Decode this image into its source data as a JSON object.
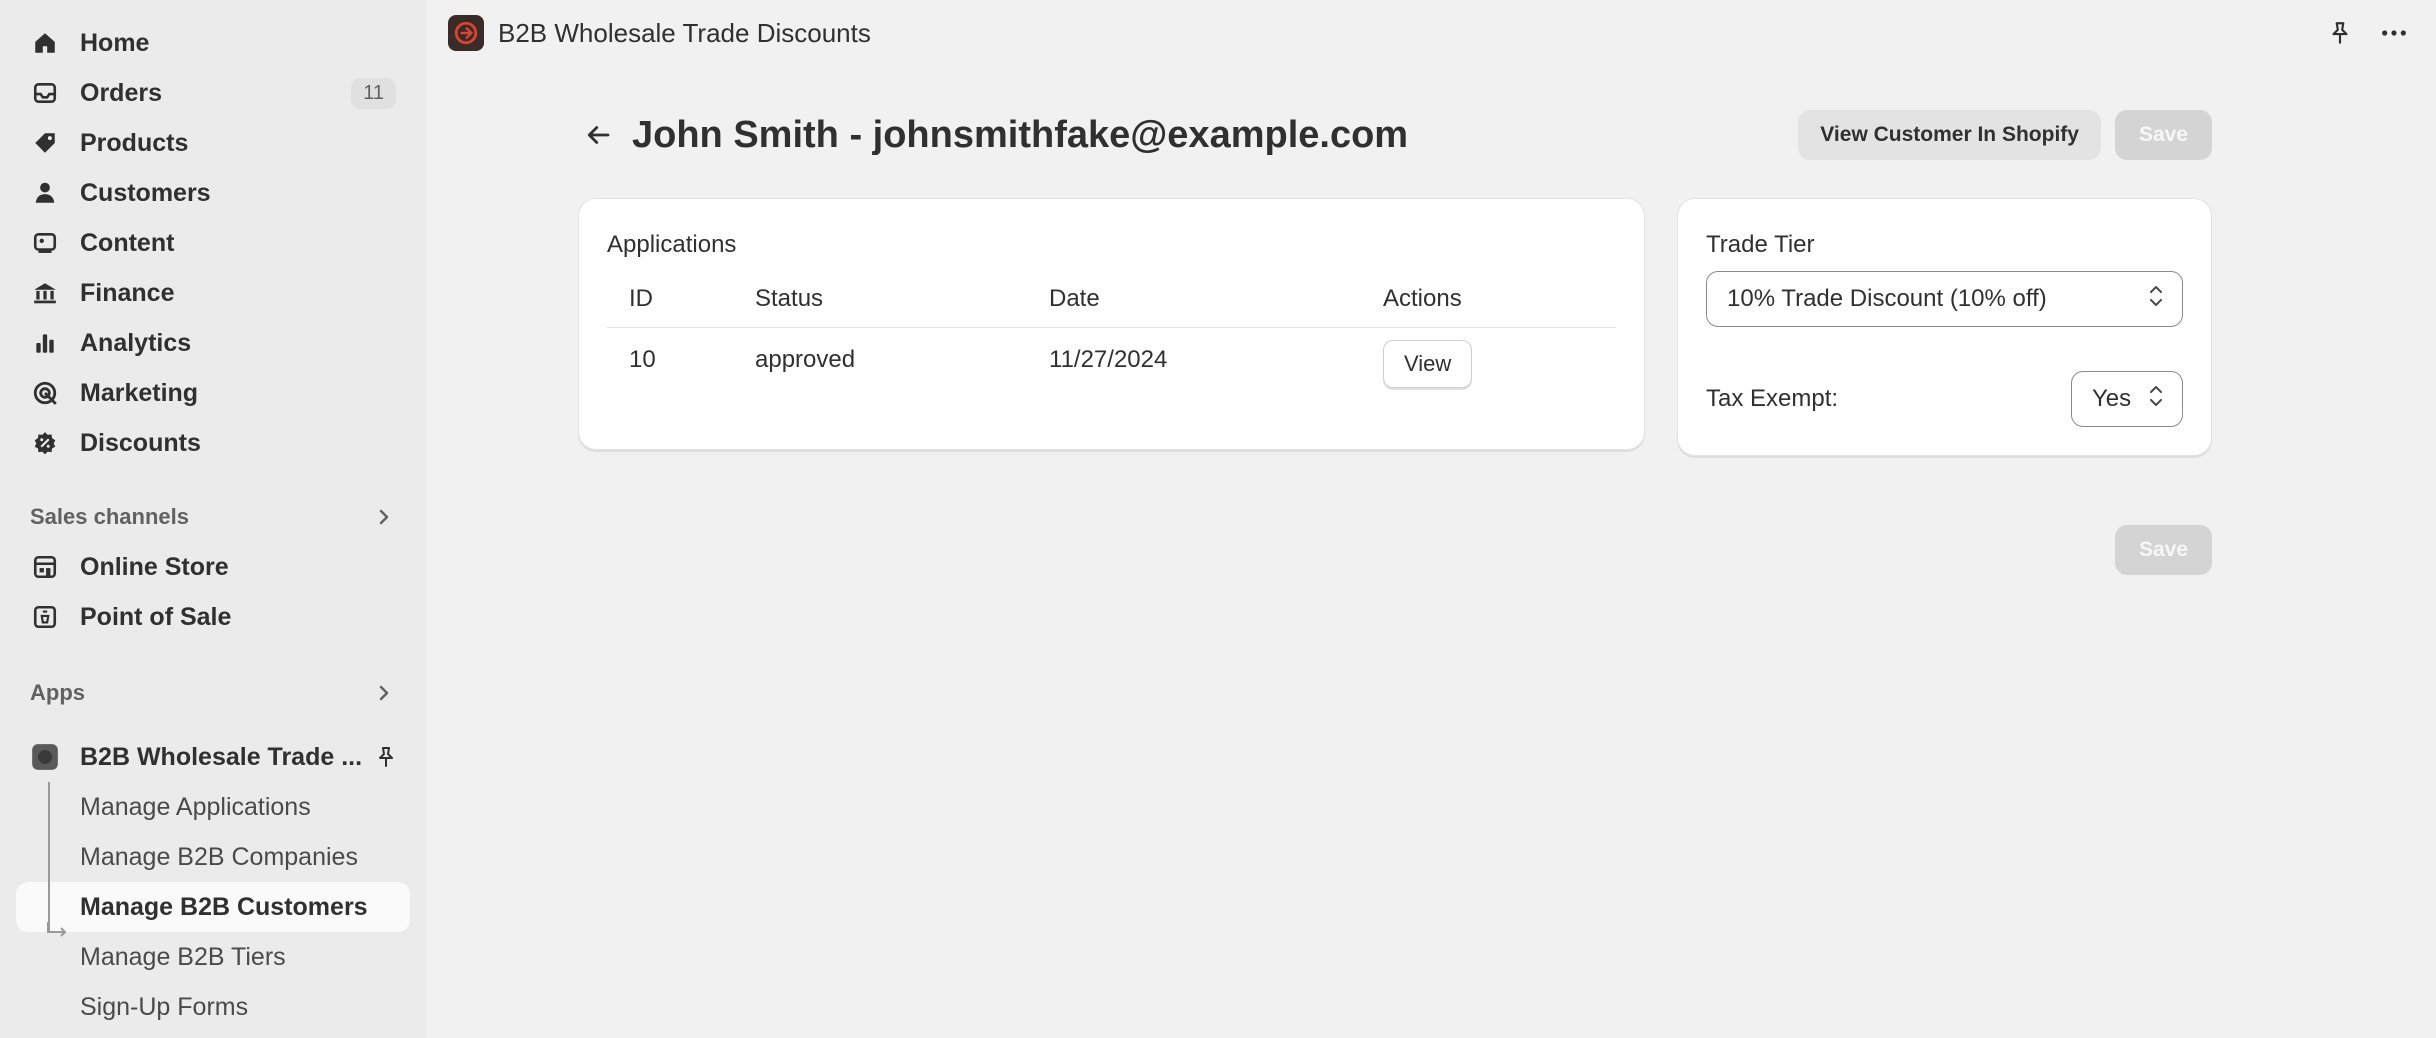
{
  "sidebar": {
    "nav": [
      {
        "label": "Home",
        "icon": "home-icon"
      },
      {
        "label": "Orders",
        "icon": "inbox-icon",
        "badge": "11"
      },
      {
        "label": "Products",
        "icon": "tag-icon"
      },
      {
        "label": "Customers",
        "icon": "person-icon"
      },
      {
        "label": "Content",
        "icon": "image-icon"
      },
      {
        "label": "Finance",
        "icon": "bank-icon"
      },
      {
        "label": "Analytics",
        "icon": "bar-chart-icon"
      },
      {
        "label": "Marketing",
        "icon": "target-icon"
      },
      {
        "label": "Discounts",
        "icon": "discount-icon"
      }
    ],
    "sales_channels": {
      "heading": "Sales channels",
      "items": [
        {
          "label": "Online Store",
          "icon": "store-icon"
        },
        {
          "label": "Point of Sale",
          "icon": "pos-icon"
        }
      ]
    },
    "apps": {
      "heading": "Apps",
      "app_name": "B2B Wholesale Trade ...",
      "sub_items": [
        {
          "label": "Manage Applications"
        },
        {
          "label": "Manage B2B Companies"
        },
        {
          "label": "Manage B2B Customers",
          "active": true
        },
        {
          "label": "Manage B2B Tiers"
        },
        {
          "label": "Sign-Up Forms"
        }
      ]
    }
  },
  "topbar": {
    "title": "B2B Wholesale Trade Discounts"
  },
  "page": {
    "title": "John Smith - johnsmithfake@example.com",
    "view_customer_label": "View Customer In Shopify",
    "save_label": "Save"
  },
  "applications": {
    "heading": "Applications",
    "columns": [
      "ID",
      "Status",
      "Date",
      "Actions"
    ],
    "rows": [
      {
        "id": "10",
        "status": "approved",
        "date": "11/27/2024",
        "action": "View"
      }
    ]
  },
  "trade": {
    "tier_label": "Trade Tier",
    "tier_value": "10% Trade Discount (10% off)",
    "tax_label": "Tax Exempt:",
    "tax_value": "Yes"
  },
  "colors": {
    "sidebar_bg": "#ebebeb",
    "page_bg": "#f1f1f1",
    "card_bg": "#ffffff",
    "disabled_btn": "#d4d4d4",
    "app_logo_accent": "#d9452f"
  }
}
